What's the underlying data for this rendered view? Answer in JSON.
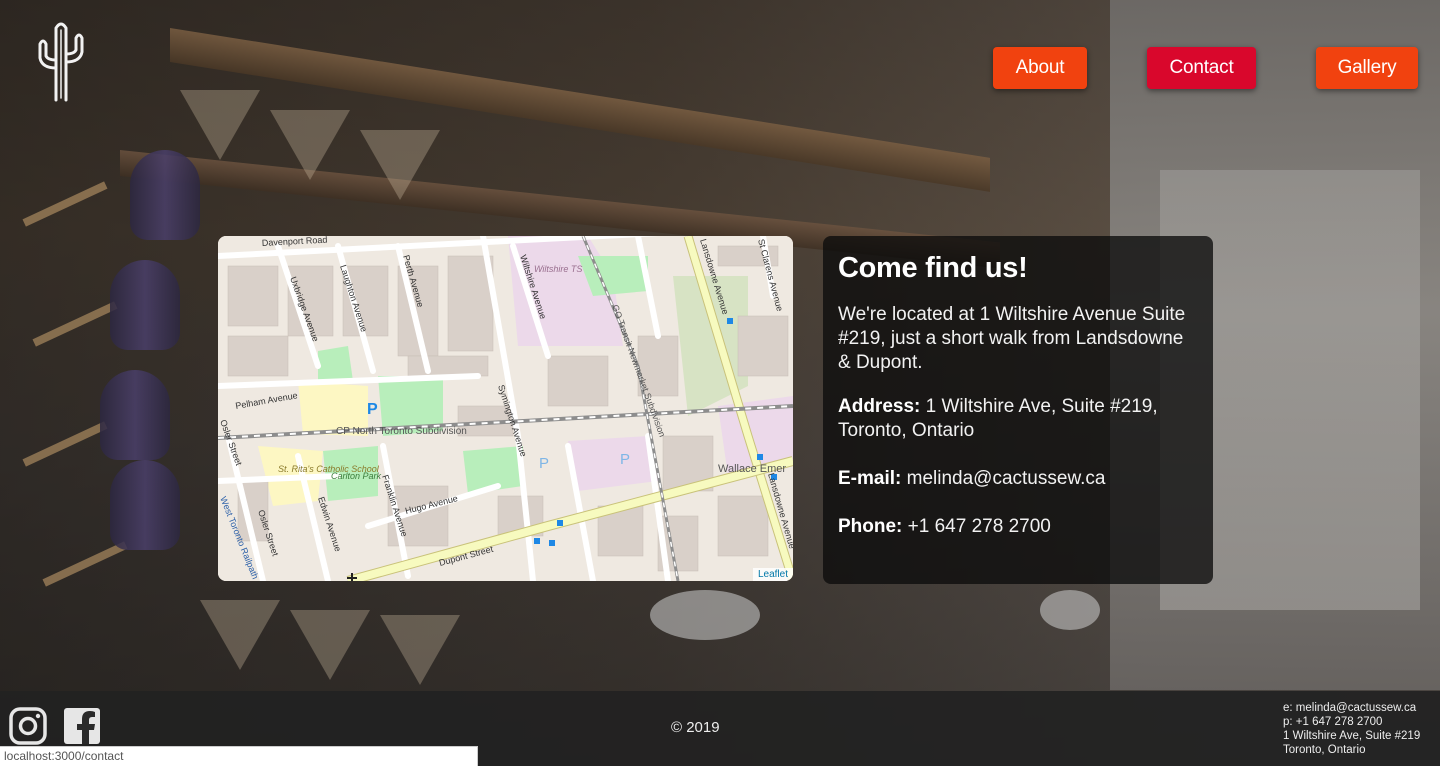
{
  "nav": {
    "about": "About",
    "contact": "Contact",
    "gallery": "Gallery"
  },
  "map": {
    "attribution": "Leaflet",
    "labels": {
      "davenport": "Davenport Road",
      "uxbridge": "Uxbridge Avenue",
      "laughton": "Laughton Avenue",
      "perth": "Perth Avenue",
      "wiltshire_ave": "Wiltshire Avenue",
      "wiltshire_ts": "Wiltshire TS",
      "go_transit": "GO Transit Newmarket Subdivision",
      "lansdowne_top": "Lansdowne Avenue",
      "st_clarens": "St Clarens Avenue",
      "pelham": "Pelham Avenue",
      "cp_north": "CP North Toronto Subdivision",
      "symington": "Symington Avenue",
      "osler_top": "Osler Street",
      "st_ritas": "St. Rita's Catholic School",
      "carlton_park": "Carlton Park",
      "edwin": "Edwin Avenue",
      "franklin": "Franklin Avenue",
      "hugo": "Hugo Avenue",
      "wallace": "Wallace Emer",
      "lansdowne_bottom": "Lansdowne Avenue",
      "osler_bottom": "Osler Street",
      "west_toronto": "West Toronto Railpath",
      "dupont": "Dupont Street"
    }
  },
  "card": {
    "heading": "Come find us!",
    "intro": "We're located at 1 Wiltshire Avenue Suite #219, just a short walk from Landsdowne & Dupont.",
    "address_label": "Address:",
    "address_value": " 1 Wiltshire Ave, Suite #219, Toronto, Ontario",
    "email_label": "E-mail:",
    "email_value": " melinda@cactussew.ca",
    "phone_label": "Phone:",
    "phone_value": " +1 647 278 2700"
  },
  "footer": {
    "copyright": "© 2019",
    "email_line": "e: melinda@cactussew.ca",
    "phone_line": "p: +1 647 278 2700",
    "address_line1": "1 Wiltshire Ave, Suite #219",
    "address_line2": "Toronto, Ontario"
  },
  "status_url": "localhost:3000/contact",
  "colors": {
    "nav_button": "#f1420f",
    "nav_button_active": "#d9072c",
    "card_bg": "#0c0c0c",
    "footer_bg": "#222222"
  },
  "icons": {
    "logo": "cactus-icon",
    "social_1": "instagram-icon",
    "social_2": "facebook-icon"
  }
}
